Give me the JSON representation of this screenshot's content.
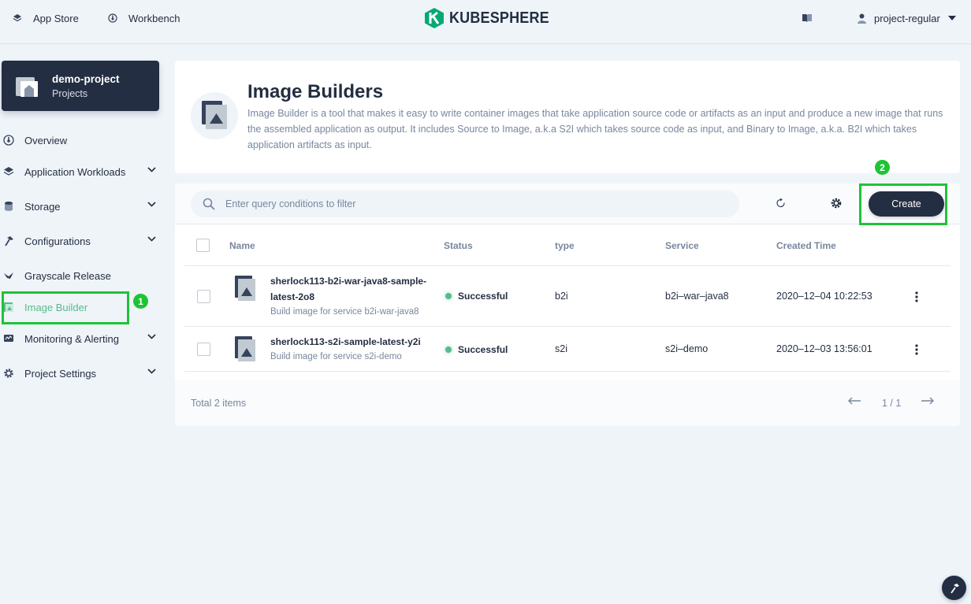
{
  "topbar": {
    "app_store": "App Store",
    "workbench": "Workbench",
    "logo_text": "KUBESPHERE",
    "user": "project-regular"
  },
  "project": {
    "name": "demo-project",
    "type": "Projects"
  },
  "sidebar": {
    "items": [
      {
        "label": "Overview",
        "icon": "dashboard-icon"
      },
      {
        "label": "Application Workloads",
        "icon": "layers-icon"
      },
      {
        "label": "Storage",
        "icon": "database-icon"
      },
      {
        "label": "Configurations",
        "icon": "hammer-icon"
      },
      {
        "label": "Grayscale Release",
        "icon": "bird-icon"
      },
      {
        "label": "Image Builder",
        "icon": "image-builder-icon"
      },
      {
        "label": "Monitoring & Alerting",
        "icon": "monitor-icon"
      },
      {
        "label": "Project Settings",
        "icon": "gear-icon"
      }
    ],
    "active": "Image Builder"
  },
  "annotations": {
    "step1": "1",
    "step2": "2",
    "highlight_color": "#1ec336"
  },
  "header": {
    "title": "Image Builders",
    "description": "Image Builder is a tool that makes it easy to write container images that take application source code or artifacts as an input and produce a new image that runs the assembled application as output. It includes Source to Image, a.k.a S2I which takes source code as input, and Binary to Image, a.k.a. B2I which takes application artifacts as input."
  },
  "toolbar": {
    "search_placeholder": "Enter query conditions to filter",
    "create_label": "Create"
  },
  "table": {
    "columns": [
      "Name",
      "Status",
      "type",
      "Service",
      "Created Time"
    ],
    "rows": [
      {
        "name_line1": "sherlock113-b2i-war-java8-sample-",
        "name_line2": "latest-2o8",
        "description": "Build image for service b2i-war-java8",
        "status": "Successful",
        "type": "b2i",
        "service": "b2i–war–java8",
        "created": "2020–12–04 10:22:53"
      },
      {
        "name_line1": "sherlock113-s2i-sample-latest-y2i",
        "name_line2": "",
        "description": "Build image for service s2i-demo",
        "status": "Successful",
        "type": "s2i",
        "service": "s2i–demo",
        "created": "2020–12–03 13:56:01"
      }
    ]
  },
  "footer": {
    "total": "Total 2 items",
    "page": "1 / 1"
  },
  "colors": {
    "primary_dark": "#242e42",
    "success": "#55bc8a",
    "background": "#eff4f9"
  }
}
